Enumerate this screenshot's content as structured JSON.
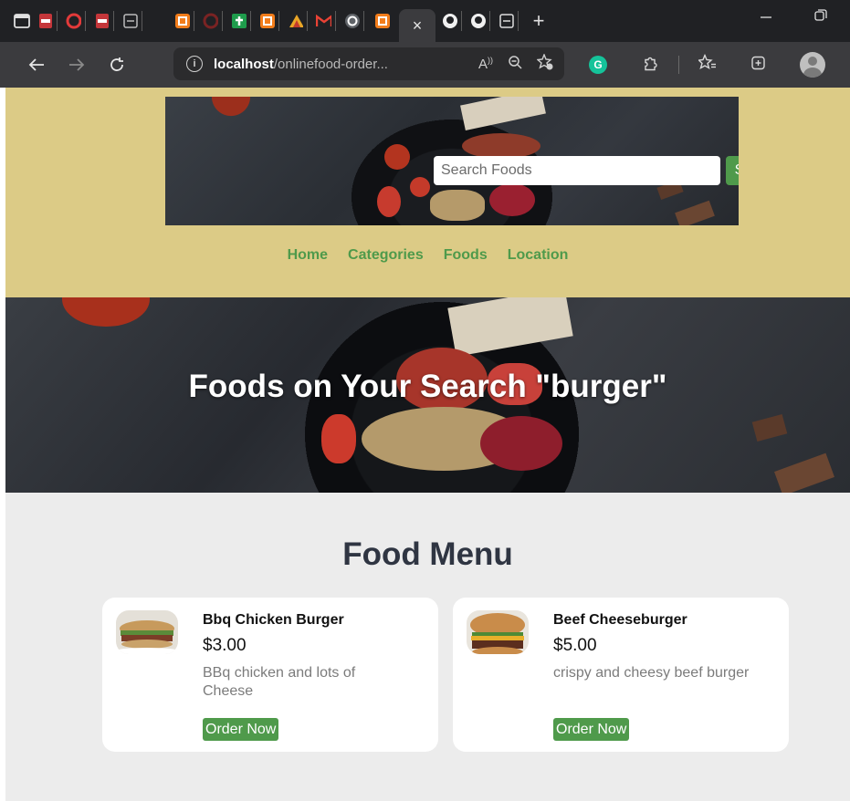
{
  "browser": {
    "tab_close_glyph": "×",
    "new_tab_glyph": "+",
    "address": {
      "host": "localhost",
      "path": "/onlinefood-order..."
    }
  },
  "header": {
    "search": {
      "placeholder": "Search Foods",
      "button_label": "Search"
    },
    "nav": [
      "Home",
      "Categories",
      "Foods",
      "Location"
    ]
  },
  "hero": {
    "title": "Foods on Your Search \"burger\""
  },
  "menu": {
    "title": "Food Menu",
    "items": [
      {
        "name": "Bbq Chicken Burger",
        "price": "$3.00",
        "description": "BBq chicken and lots of Cheese",
        "button": "Order Now"
      },
      {
        "name": "Beef Cheeseburger",
        "price": "$5.00",
        "description": "crispy and cheesy beef burger",
        "button": "Order Now"
      }
    ]
  },
  "colors": {
    "header_bg": "#dccb86",
    "accent_green": "#4f9a4b",
    "page_bg": "#ececec",
    "title_text": "#2f3542"
  }
}
